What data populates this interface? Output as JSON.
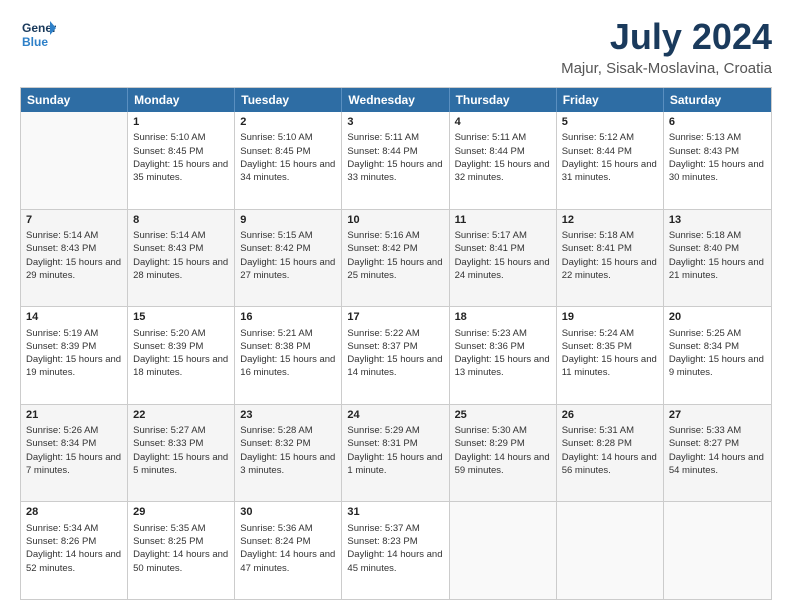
{
  "logo": {
    "line1": "General",
    "line2": "Blue"
  },
  "title": "July 2024",
  "subtitle": "Majur, Sisak-Moslavina, Croatia",
  "days": [
    "Sunday",
    "Monday",
    "Tuesday",
    "Wednesday",
    "Thursday",
    "Friday",
    "Saturday"
  ],
  "weeks": [
    [
      {
        "day": "",
        "sunrise": "",
        "sunset": "",
        "daylight": ""
      },
      {
        "day": "1",
        "sunrise": "Sunrise: 5:10 AM",
        "sunset": "Sunset: 8:45 PM",
        "daylight": "Daylight: 15 hours and 35 minutes."
      },
      {
        "day": "2",
        "sunrise": "Sunrise: 5:10 AM",
        "sunset": "Sunset: 8:45 PM",
        "daylight": "Daylight: 15 hours and 34 minutes."
      },
      {
        "day": "3",
        "sunrise": "Sunrise: 5:11 AM",
        "sunset": "Sunset: 8:44 PM",
        "daylight": "Daylight: 15 hours and 33 minutes."
      },
      {
        "day": "4",
        "sunrise": "Sunrise: 5:11 AM",
        "sunset": "Sunset: 8:44 PM",
        "daylight": "Daylight: 15 hours and 32 minutes."
      },
      {
        "day": "5",
        "sunrise": "Sunrise: 5:12 AM",
        "sunset": "Sunset: 8:44 PM",
        "daylight": "Daylight: 15 hours and 31 minutes."
      },
      {
        "day": "6",
        "sunrise": "Sunrise: 5:13 AM",
        "sunset": "Sunset: 8:43 PM",
        "daylight": "Daylight: 15 hours and 30 minutes."
      }
    ],
    [
      {
        "day": "7",
        "sunrise": "Sunrise: 5:14 AM",
        "sunset": "Sunset: 8:43 PM",
        "daylight": "Daylight: 15 hours and 29 minutes."
      },
      {
        "day": "8",
        "sunrise": "Sunrise: 5:14 AM",
        "sunset": "Sunset: 8:43 PM",
        "daylight": "Daylight: 15 hours and 28 minutes."
      },
      {
        "day": "9",
        "sunrise": "Sunrise: 5:15 AM",
        "sunset": "Sunset: 8:42 PM",
        "daylight": "Daylight: 15 hours and 27 minutes."
      },
      {
        "day": "10",
        "sunrise": "Sunrise: 5:16 AM",
        "sunset": "Sunset: 8:42 PM",
        "daylight": "Daylight: 15 hours and 25 minutes."
      },
      {
        "day": "11",
        "sunrise": "Sunrise: 5:17 AM",
        "sunset": "Sunset: 8:41 PM",
        "daylight": "Daylight: 15 hours and 24 minutes."
      },
      {
        "day": "12",
        "sunrise": "Sunrise: 5:18 AM",
        "sunset": "Sunset: 8:41 PM",
        "daylight": "Daylight: 15 hours and 22 minutes."
      },
      {
        "day": "13",
        "sunrise": "Sunrise: 5:18 AM",
        "sunset": "Sunset: 8:40 PM",
        "daylight": "Daylight: 15 hours and 21 minutes."
      }
    ],
    [
      {
        "day": "14",
        "sunrise": "Sunrise: 5:19 AM",
        "sunset": "Sunset: 8:39 PM",
        "daylight": "Daylight: 15 hours and 19 minutes."
      },
      {
        "day": "15",
        "sunrise": "Sunrise: 5:20 AM",
        "sunset": "Sunset: 8:39 PM",
        "daylight": "Daylight: 15 hours and 18 minutes."
      },
      {
        "day": "16",
        "sunrise": "Sunrise: 5:21 AM",
        "sunset": "Sunset: 8:38 PM",
        "daylight": "Daylight: 15 hours and 16 minutes."
      },
      {
        "day": "17",
        "sunrise": "Sunrise: 5:22 AM",
        "sunset": "Sunset: 8:37 PM",
        "daylight": "Daylight: 15 hours and 14 minutes."
      },
      {
        "day": "18",
        "sunrise": "Sunrise: 5:23 AM",
        "sunset": "Sunset: 8:36 PM",
        "daylight": "Daylight: 15 hours and 13 minutes."
      },
      {
        "day": "19",
        "sunrise": "Sunrise: 5:24 AM",
        "sunset": "Sunset: 8:35 PM",
        "daylight": "Daylight: 15 hours and 11 minutes."
      },
      {
        "day": "20",
        "sunrise": "Sunrise: 5:25 AM",
        "sunset": "Sunset: 8:34 PM",
        "daylight": "Daylight: 15 hours and 9 minutes."
      }
    ],
    [
      {
        "day": "21",
        "sunrise": "Sunrise: 5:26 AM",
        "sunset": "Sunset: 8:34 PM",
        "daylight": "Daylight: 15 hours and 7 minutes."
      },
      {
        "day": "22",
        "sunrise": "Sunrise: 5:27 AM",
        "sunset": "Sunset: 8:33 PM",
        "daylight": "Daylight: 15 hours and 5 minutes."
      },
      {
        "day": "23",
        "sunrise": "Sunrise: 5:28 AM",
        "sunset": "Sunset: 8:32 PM",
        "daylight": "Daylight: 15 hours and 3 minutes."
      },
      {
        "day": "24",
        "sunrise": "Sunrise: 5:29 AM",
        "sunset": "Sunset: 8:31 PM",
        "daylight": "Daylight: 15 hours and 1 minute."
      },
      {
        "day": "25",
        "sunrise": "Sunrise: 5:30 AM",
        "sunset": "Sunset: 8:29 PM",
        "daylight": "Daylight: 14 hours and 59 minutes."
      },
      {
        "day": "26",
        "sunrise": "Sunrise: 5:31 AM",
        "sunset": "Sunset: 8:28 PM",
        "daylight": "Daylight: 14 hours and 56 minutes."
      },
      {
        "day": "27",
        "sunrise": "Sunrise: 5:33 AM",
        "sunset": "Sunset: 8:27 PM",
        "daylight": "Daylight: 14 hours and 54 minutes."
      }
    ],
    [
      {
        "day": "28",
        "sunrise": "Sunrise: 5:34 AM",
        "sunset": "Sunset: 8:26 PM",
        "daylight": "Daylight: 14 hours and 52 minutes."
      },
      {
        "day": "29",
        "sunrise": "Sunrise: 5:35 AM",
        "sunset": "Sunset: 8:25 PM",
        "daylight": "Daylight: 14 hours and 50 minutes."
      },
      {
        "day": "30",
        "sunrise": "Sunrise: 5:36 AM",
        "sunset": "Sunset: 8:24 PM",
        "daylight": "Daylight: 14 hours and 47 minutes."
      },
      {
        "day": "31",
        "sunrise": "Sunrise: 5:37 AM",
        "sunset": "Sunset: 8:23 PM",
        "daylight": "Daylight: 14 hours and 45 minutes."
      },
      {
        "day": "",
        "sunrise": "",
        "sunset": "",
        "daylight": ""
      },
      {
        "day": "",
        "sunrise": "",
        "sunset": "",
        "daylight": ""
      },
      {
        "day": "",
        "sunrise": "",
        "sunset": "",
        "daylight": ""
      }
    ]
  ]
}
